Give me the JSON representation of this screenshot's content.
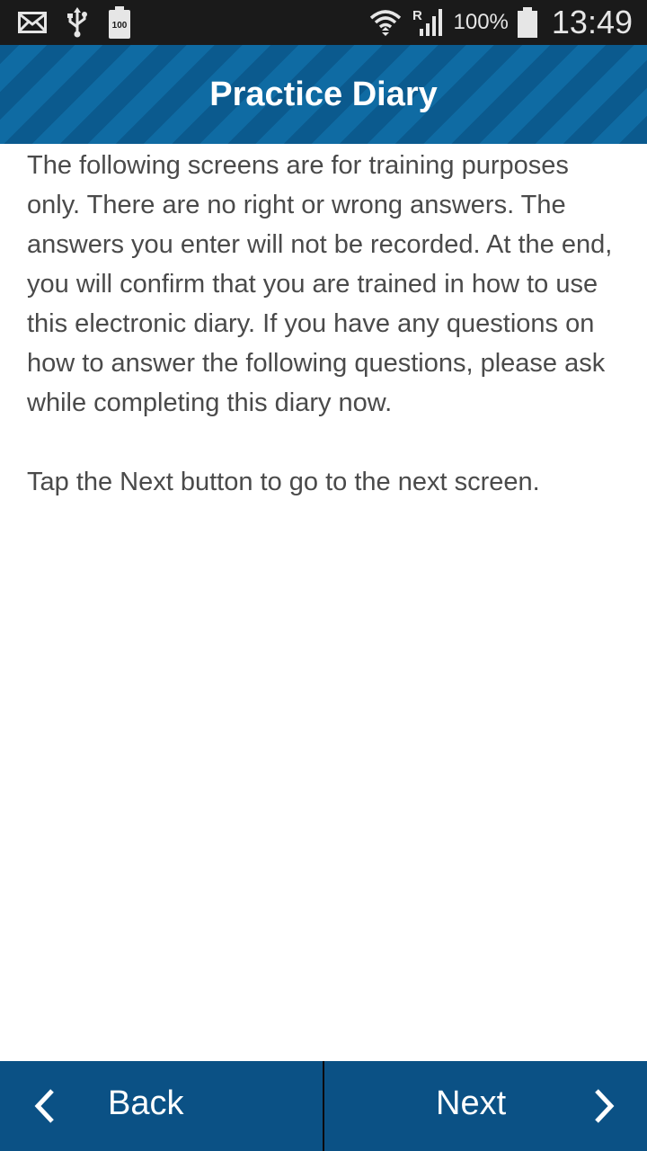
{
  "status_bar": {
    "left_icons": [
      "mail-icon",
      "usb-icon",
      "battery-100-icon"
    ],
    "right_icons": [
      "wifi-icon",
      "roaming-signal-icon",
      "battery-icon"
    ],
    "battery_label": "100",
    "battery_percent": "100%",
    "time": "13:49"
  },
  "header": {
    "title": "Practice Diary"
  },
  "content": {
    "paragraph_1": "The following screens are for training purposes only. There are no right or wrong answers. The answers you enter will not be recorded. At the end, you will confirm that you are trained in how to use this electronic diary. If you have any questions on how to answer the following questions, please ask while completing this diary now.",
    "paragraph_2": "Tap the Next button to go to the next screen."
  },
  "footer": {
    "back_label": "Back",
    "next_label": "Next",
    "back_icon": "chevron-left-icon",
    "next_icon": "chevron-right-icon"
  },
  "colors": {
    "header_bg": "#0b5a8e",
    "footer_bg": "#0b5185",
    "status_bar_bg": "#1a1a1a",
    "body_text": "#4a4a4a"
  }
}
